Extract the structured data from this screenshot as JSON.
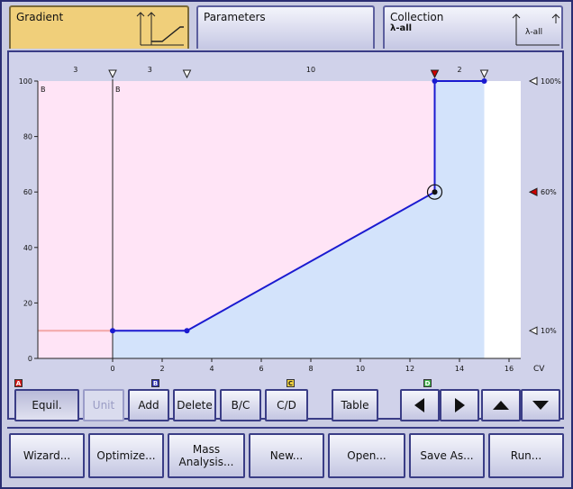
{
  "tabs": [
    {
      "label": "Gradient",
      "active": true
    },
    {
      "label": "Parameters",
      "active": false
    },
    {
      "label": "Collection",
      "sub": "λ-all",
      "icon_label": "λ-all",
      "active": false
    }
  ],
  "chart_data": {
    "type": "line",
    "xlabel": "CV",
    "xlim": [
      -3,
      16
    ],
    "ylim": [
      0,
      100
    ],
    "x_ticks": [
      0,
      2,
      4,
      6,
      8,
      10,
      12,
      14,
      16
    ],
    "y_ticks": [
      0,
      20,
      40,
      60,
      80,
      100
    ],
    "y_axis_letter": "B",
    "equil_letter": "B",
    "segments_top": [
      {
        "x": -1.5,
        "label": "3"
      },
      {
        "x": 1.5,
        "label": "3"
      },
      {
        "x": 8,
        "label": "10"
      },
      {
        "x": 14,
        "label": "2"
      }
    ],
    "top_markers": [
      {
        "x": 0,
        "color": "#ffffff"
      },
      {
        "x": 3,
        "color": "#ffffff"
      },
      {
        "x": 13,
        "color": "#cc0000"
      },
      {
        "x": 15,
        "color": "#ffffff"
      }
    ],
    "right_markers": [
      {
        "y": 100,
        "label": "100%",
        "color": "#ffffff"
      },
      {
        "y": 60,
        "label": "60%",
        "color": "#cc0000"
      },
      {
        "y": 10,
        "label": "10%",
        "color": "#ffffff"
      }
    ],
    "equil_series": {
      "x": [
        -3,
        0
      ],
      "y": [
        10,
        10
      ]
    },
    "series": [
      {
        "x": [
          0,
          3,
          13,
          13,
          15
        ],
        "y": [
          10,
          10,
          60,
          100,
          100
        ]
      }
    ],
    "selected_point": {
      "x": 13,
      "y": 60
    },
    "colors": {
      "equil_bg": "#ffe4f6",
      "method_bg": "#d3e3fb",
      "line": "#1a1ad0",
      "equil_line": "#f3a7a7"
    }
  },
  "markers": {
    "a": "A",
    "b": "B",
    "c": "C",
    "d": "D"
  },
  "buttons": {
    "equil": "Equil.",
    "unit": "Unit",
    "add": "Add",
    "delete": "Delete",
    "bc": "B/C",
    "cd": "C/D",
    "table": "Table",
    "wizard": "Wizard...",
    "optimize": "Optimize...",
    "mass1": "Mass",
    "mass2": "Analysis...",
    "new": "New...",
    "open": "Open...",
    "saveas": "Save As...",
    "run": "Run..."
  },
  "nav_icons": [
    "left-arrow-icon",
    "right-arrow-icon",
    "up-arrow-icon",
    "down-arrow-icon"
  ]
}
